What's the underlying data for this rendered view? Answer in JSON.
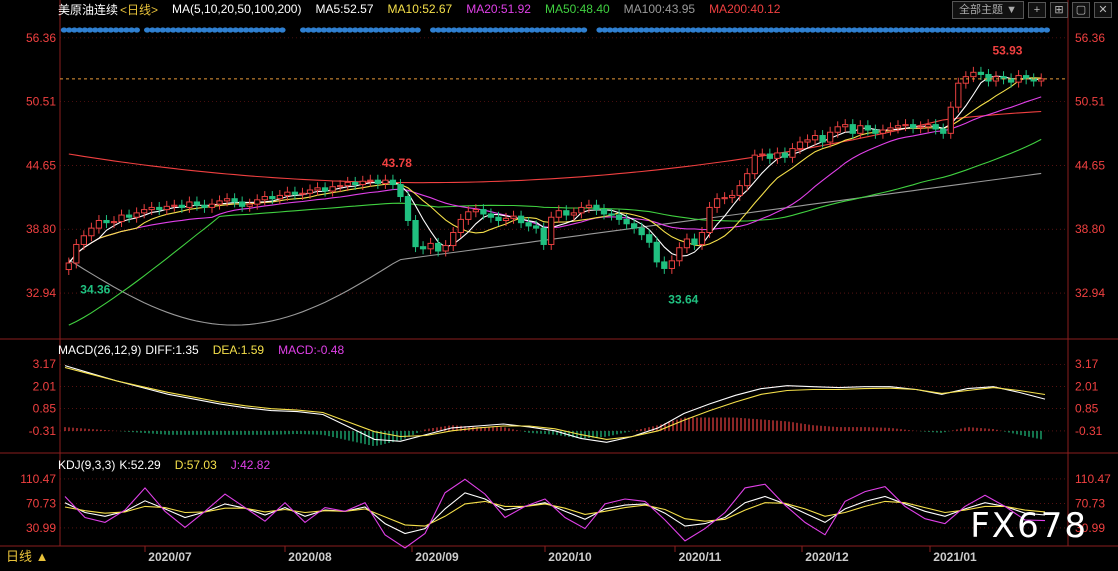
{
  "header": {
    "title": "美原油连续",
    "period": "<日线>",
    "ma_params": "MA(5,10,20,50,100,200)",
    "ma": [
      {
        "label": "MA5:52.57",
        "color": "#ffffff"
      },
      {
        "label": "MA10:52.67",
        "color": "#f5e04a"
      },
      {
        "label": "MA20:51.92",
        "color": "#e040e8"
      },
      {
        "label": "MA50:48.40",
        "color": "#40d040"
      },
      {
        "label": "MA100:43.95",
        "color": "#9a9a9a"
      },
      {
        "label": "MA200:40.12",
        "color": "#f04040"
      }
    ]
  },
  "toolbar": {
    "theme_label": "全部主题",
    "theme_arrow": "▼",
    "btn_plus": "+",
    "btn_fit": "⊞",
    "btn_window": "▢",
    "btn_close": "✕"
  },
  "macd_header": {
    "title": "MACD(26,12,9)",
    "diff": "DIFF:1.35",
    "dea": "DEA:1.59",
    "macd": "MACD:-0.48"
  },
  "kdj_header": {
    "title": "KDJ(9,3,3)",
    "k": "K:52.29",
    "d": "D:57.03",
    "j": "J:42.82"
  },
  "bottom_tab": "日线 ▲",
  "watermark": "FX678",
  "colors": {
    "up": "#e84040",
    "down": "#20c080",
    "grid": "#8a1e1e",
    "axis_text": "#f04040",
    "bg": "#000000",
    "dots": "#2f7fd0"
  },
  "chart_data": [
    {
      "type": "candlestick",
      "name": "price",
      "ylim": [
        29.0,
        58.0
      ],
      "y_ticks": [
        "56.36",
        "50.51",
        "44.65",
        "38.80",
        "32.94"
      ],
      "x_ticks": [
        "2020/07",
        "2020/08",
        "2020/09",
        "2020/10",
        "2020/11",
        "2020/12",
        "2021/01"
      ],
      "annotations": [
        {
          "label": "53.93",
          "kind": "high"
        },
        {
          "label": "43.78",
          "kind": "high"
        },
        {
          "label": "34.36",
          "kind": "low"
        },
        {
          "label": "33.64",
          "kind": "low"
        }
      ],
      "last_price": 52.6,
      "close_series": [
        35.7,
        37.4,
        38.2,
        38.9,
        39.6,
        39.4,
        39.5,
        40.1,
        39.9,
        40.3,
        40.6,
        40.8,
        40.6,
        40.9,
        41.0,
        40.8,
        41.3,
        41.0,
        40.8,
        41.1,
        41.4,
        41.6,
        41.3,
        40.9,
        41.1,
        41.5,
        41.8,
        41.6,
        41.9,
        42.2,
        42.0,
        42.1,
        42.4,
        42.6,
        42.3,
        42.7,
        42.8,
        43.1,
        42.9,
        43.2,
        43.3,
        43.0,
        43.3,
        42.9,
        41.8,
        39.6,
        37.2,
        37.0,
        37.5,
        36.8,
        37.3,
        38.5,
        39.7,
        40.4,
        40.6,
        40.2,
        39.9,
        39.6,
        39.8,
        40.0,
        39.4,
        39.1,
        38.9,
        37.4,
        39.9,
        40.5,
        40.1,
        40.3,
        40.8,
        41.0,
        40.6,
        40.2,
        40.1,
        39.7,
        39.3,
        38.9,
        38.3,
        37.6,
        35.8,
        35.2,
        35.9,
        37.1,
        37.9,
        37.4,
        38.5,
        40.8,
        41.6,
        41.7,
        41.9,
        42.8,
        43.9,
        45.6,
        45.7,
        45.3,
        45.8,
        45.4,
        46.2,
        46.8,
        47.0,
        47.4,
        46.8,
        47.7,
        48.2,
        48.4,
        47.6,
        48.3,
        47.9,
        47.6,
        47.9,
        48.1,
        48.3,
        48.4,
        48.1,
        48.2,
        48.4,
        48.0,
        47.6,
        50.0,
        52.2,
        52.8,
        53.2,
        53.0,
        52.4,
        52.8,
        52.6,
        52.3,
        52.9,
        52.6,
        52.4,
        52.6
      ],
      "up_flags": [
        1,
        1,
        1,
        1,
        1,
        0,
        1,
        1,
        0,
        1,
        1,
        1,
        0,
        1,
        1,
        0,
        1,
        0,
        0,
        1,
        1,
        1,
        0,
        0,
        1,
        1,
        1,
        0,
        1,
        1,
        0,
        1,
        1,
        1,
        0,
        1,
        1,
        1,
        0,
        1,
        1,
        0,
        1,
        0,
        0,
        0,
        0,
        0,
        1,
        0,
        1,
        1,
        1,
        1,
        1,
        0,
        0,
        0,
        1,
        1,
        0,
        0,
        0,
        0,
        1,
        1,
        0,
        1,
        1,
        1,
        0,
        0,
        0,
        0,
        0,
        0,
        0,
        0,
        0,
        0,
        1,
        1,
        1,
        0,
        1,
        1,
        1,
        1,
        1,
        1,
        1,
        1,
        1,
        0,
        1,
        0,
        1,
        1,
        1,
        1,
        0,
        1,
        1,
        1,
        0,
        1,
        0,
        0,
        1,
        1,
        1,
        1,
        0,
        1,
        1,
        0,
        0,
        1,
        1,
        1,
        1,
        0,
        0,
        1,
        0,
        0,
        1,
        0,
        0,
        1
      ]
    },
    {
      "type": "line",
      "name": "macd",
      "ylim": [
        -1.2,
        3.6
      ],
      "y_ticks": [
        "3.17",
        "2.01",
        "0.85",
        "-0.31"
      ],
      "series": [
        {
          "name": "DIFF",
          "values": [
            3.1,
            2.7,
            2.3,
            1.95,
            1.6,
            1.35,
            1.1,
            0.9,
            0.75,
            0.7,
            0.55,
            -0.1,
            -0.75,
            -0.85,
            -0.5,
            -0.15,
            -0.05,
            0.05,
            -0.1,
            -0.3,
            -0.7,
            -0.9,
            -0.6,
            -0.15,
            0.6,
            1.1,
            1.55,
            1.9,
            2.05,
            2.0,
            1.95,
            2.0,
            2.0,
            1.85,
            1.6,
            1.9,
            2.0,
            1.7,
            1.35
          ]
        },
        {
          "name": "DEA",
          "values": [
            3.0,
            2.65,
            2.3,
            2.0,
            1.7,
            1.45,
            1.2,
            1.0,
            0.85,
            0.78,
            0.65,
            0.15,
            -0.35,
            -0.6,
            -0.55,
            -0.3,
            -0.15,
            -0.05,
            -0.05,
            -0.2,
            -0.5,
            -0.75,
            -0.6,
            -0.3,
            0.25,
            0.75,
            1.2,
            1.6,
            1.8,
            1.85,
            1.85,
            1.9,
            1.92,
            1.85,
            1.65,
            1.8,
            1.95,
            1.8,
            1.59
          ]
        }
      ]
    },
    {
      "type": "line",
      "name": "kdj",
      "ylim": [
        5.0,
        125.0
      ],
      "y_ticks": [
        "110.47",
        "70.73",
        "30.99"
      ],
      "series": [
        {
          "name": "K",
          "values": [
            72,
            56,
            50,
            58,
            75,
            62,
            48,
            57,
            70,
            63,
            52,
            64,
            50,
            60,
            58,
            65,
            38,
            22,
            30,
            62,
            88,
            78,
            60,
            66,
            72,
            58,
            45,
            62,
            68,
            70,
            55,
            34,
            38,
            48,
            72,
            82,
            70,
            55,
            40,
            62,
            74,
            82,
            70,
            58,
            50,
            62,
            72,
            66,
            55,
            52
          ]
        },
        {
          "name": "D",
          "values": [
            65,
            59,
            55,
            57,
            66,
            64,
            56,
            57,
            63,
            63,
            57,
            61,
            56,
            59,
            58,
            62,
            49,
            36,
            34,
            50,
            70,
            74,
            66,
            66,
            70,
            63,
            53,
            58,
            64,
            68,
            61,
            46,
            42,
            45,
            60,
            72,
            71,
            62,
            50,
            56,
            66,
            74,
            72,
            64,
            56,
            60,
            66,
            66,
            60,
            57
          ]
        },
        {
          "name": "J",
          "values": [
            82,
            48,
            40,
            60,
            96,
            58,
            32,
            58,
            86,
            64,
            42,
            72,
            40,
            64,
            58,
            72,
            20,
            -5,
            22,
            88,
            110,
            86,
            48,
            66,
            78,
            48,
            30,
            70,
            78,
            74,
            44,
            10,
            30,
            56,
            96,
            102,
            68,
            40,
            20,
            74,
            90,
            98,
            66,
            46,
            38,
            66,
            84,
            66,
            44,
            43
          ]
        }
      ]
    }
  ]
}
